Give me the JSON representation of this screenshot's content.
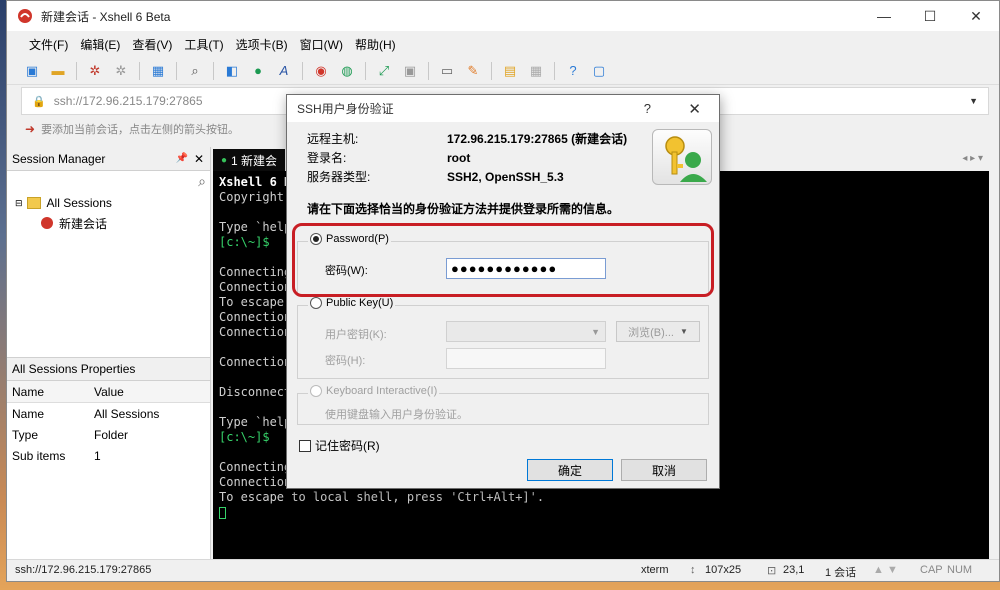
{
  "window": {
    "title": "新建会话 - Xshell 6 Beta",
    "controls": {
      "minimize": "—",
      "maximize": "☐",
      "close": "✕"
    }
  },
  "menu": [
    "文件(F)",
    "编辑(E)",
    "查看(V)",
    "工具(T)",
    "选项卡(B)",
    "窗口(W)",
    "帮助(H)"
  ],
  "address": {
    "value": "ssh://172.96.215.179:27865"
  },
  "hint": {
    "text": "要添加当前会话，点击左侧的箭头按钮。"
  },
  "session_manager": {
    "title": "Session Manager",
    "tree": [
      {
        "label": "All Sessions",
        "icon": "folder-icon"
      },
      {
        "label": "新建会话",
        "icon": "session-icon"
      }
    ]
  },
  "properties": {
    "title": "All Sessions Properties",
    "columns": [
      "Name",
      "Value"
    ],
    "rows": [
      {
        "name": "Name",
        "value": "All Sessions"
      },
      {
        "name": "Type",
        "value": "Folder"
      },
      {
        "name": "Sub items",
        "value": "1"
      }
    ]
  },
  "terminal": {
    "tab_label": "1 新建会",
    "lines": [
      {
        "text": "Xshell 6 B",
        "style": "bold"
      },
      {
        "text": "Copyright",
        "style": "normal"
      },
      {
        "text": "",
        "style": "normal"
      },
      {
        "text": "Type `help",
        "style": "normal"
      },
      {
        "text": "[c:\\~]$",
        "style": "prompt"
      },
      {
        "text": "",
        "style": "normal"
      },
      {
        "text": "Connecting",
        "style": "normal"
      },
      {
        "text": "Connection",
        "style": "normal"
      },
      {
        "text": "To escape",
        "style": "normal"
      },
      {
        "text": "Connection",
        "style": "normal"
      },
      {
        "text": "Connection",
        "style": "normal"
      },
      {
        "text": "",
        "style": "normal"
      },
      {
        "text": "Connection",
        "style": "normal"
      },
      {
        "text": "",
        "style": "normal"
      },
      {
        "text": "Disconnect",
        "style": "normal"
      },
      {
        "text": "",
        "style": "normal"
      },
      {
        "text": "Type `help",
        "style": "normal"
      },
      {
        "text": "[c:\\~]$",
        "style": "prompt"
      },
      {
        "text": "",
        "style": "normal"
      },
      {
        "text": "Connecting",
        "style": "normal"
      },
      {
        "text": "Connection",
        "style": "normal"
      },
      {
        "text": "To escape to local shell, press 'Ctrl+Alt+]'.",
        "style": "normal"
      }
    ]
  },
  "status": {
    "address": "ssh://172.96.215.179:27865",
    "terminal_type": "xterm",
    "size": "107x25",
    "cursor": "23,1",
    "sessions": "1 会话",
    "caps": "CAP",
    "num": "NUM"
  },
  "dialog": {
    "title": "SSH用户身份验证",
    "help": "?",
    "close": "✕",
    "info": [
      {
        "label": "远程主机:",
        "value": "172.96.215.179:27865 (新建会话)"
      },
      {
        "label": "登录名:",
        "value": "root"
      },
      {
        "label": "服务器类型:",
        "value": "SSH2, OpenSSH_5.3"
      }
    ],
    "instruction": "请在下面选择恰当的身份验证方法并提供登录所需的信息。",
    "password": {
      "label": "Password(P)",
      "field_label": "密码(W):",
      "value": "●●●●●●●●●●●●",
      "selected": true
    },
    "public_key": {
      "label": "Public Key(U)",
      "user_key_label": "用户密钥(K):",
      "browse_label": "浏览(B)...",
      "passphrase_label": "密码(H):",
      "selected": false
    },
    "keyboard": {
      "label": "Keyboard Interactive(I)",
      "description": "使用键盘输入用户身份验证。",
      "selected": false
    },
    "remember_label": "记住密码(R)",
    "ok_label": "确定",
    "cancel_label": "取消"
  }
}
